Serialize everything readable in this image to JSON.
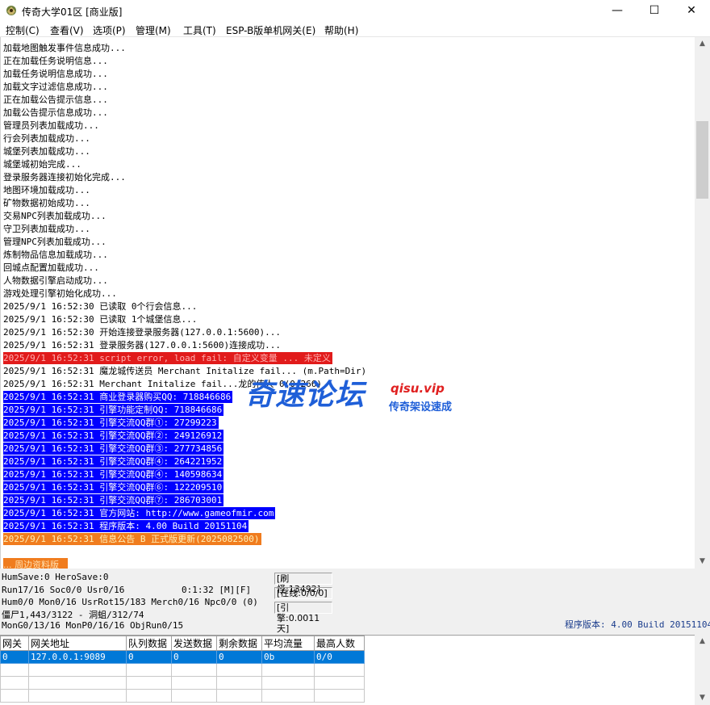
{
  "window": {
    "title": "传奇大学01区 [商业版]",
    "min_glyph": "—",
    "max_glyph": "☐",
    "close_glyph": "✕"
  },
  "menu": [
    {
      "label": "控制(C)"
    },
    {
      "label": "查看(V)"
    },
    {
      "label": "选项(P)"
    },
    {
      "label": "管理(M)"
    },
    {
      "label": "工具(T)"
    },
    {
      "label": "ESP-B版单机网关(E)"
    },
    {
      "label": "帮助(H)"
    }
  ],
  "log": {
    "lines": [
      {
        "text": "加载地图触发事件信息成功...",
        "style": ""
      },
      {
        "text": "正在加载任务说明信息...",
        "style": ""
      },
      {
        "text": "加载任务说明信息成功...",
        "style": ""
      },
      {
        "text": "加载文字过滤信息成功...",
        "style": ""
      },
      {
        "text": "正在加载公告提示信息...",
        "style": ""
      },
      {
        "text": "加载公告提示信息成功...",
        "style": ""
      },
      {
        "text": "管理员列表加载成功...",
        "style": ""
      },
      {
        "text": "行会列表加载成功...",
        "style": ""
      },
      {
        "text": "城堡列表加载成功...",
        "style": ""
      },
      {
        "text": "城堡城初始完成...",
        "style": ""
      },
      {
        "text": "登录服务器连接初始化完成...",
        "style": ""
      },
      {
        "text": "地图环境加载成功...",
        "style": ""
      },
      {
        "text": "矿物数据初始成功...",
        "style": ""
      },
      {
        "text": "交易NPC列表加载成功...",
        "style": ""
      },
      {
        "text": "守卫列表加载成功...",
        "style": ""
      },
      {
        "text": "管理NPC列表加载成功...",
        "style": ""
      },
      {
        "text": "炼制物品信息加载成功...",
        "style": ""
      },
      {
        "text": "回城点配置加载成功...",
        "style": ""
      },
      {
        "text": "人物数据引擎启动成功...",
        "style": ""
      },
      {
        "text": "游戏处理引擎初始化成功...",
        "style": ""
      },
      {
        "text": "2025/9/1 16:52:30 已读取 0个行会信息...",
        "style": ""
      },
      {
        "text": "2025/9/1 16:52:30 已读取 1个城堡信息...",
        "style": ""
      },
      {
        "text": "2025/9/1 16:52:30 开始连接登录服务器(127.0.0.1:5600)...",
        "style": ""
      },
      {
        "text": "2025/9/1 16:52:31 登录服务器(127.0.0.1:5600)连接成功...",
        "style": ""
      },
      {
        "text": "2025/9/1 16:52:31 script error, load fail: 自定义变量 ... 未定义",
        "style": "red"
      },
      {
        "text": "2025/9/1 16:52:31 魔龙城传送员 Merchant Initalize fail... (m.Path=Dir)",
        "style": ""
      },
      {
        "text": "2025/9/1 16:52:31 Merchant Initalize fail...龙的传人 0(0:266)",
        "style": ""
      },
      {
        "text": "2025/9/1 16:52:31 商业登录器购买QQ: 718846686",
        "style": "blue"
      },
      {
        "text": "2025/9/1 16:52:31 引擎功能定制QQ: 718846686",
        "style": "blue"
      },
      {
        "text": "2025/9/1 16:52:31 引擎交流QQ群①: 27299223",
        "style": "blue"
      },
      {
        "text": "2025/9/1 16:52:31 引擎交流QQ群②: 249126912",
        "style": "blue"
      },
      {
        "text": "2025/9/1 16:52:31 引擎交流QQ群③: 277734856",
        "style": "blue"
      },
      {
        "text": "2025/9/1 16:52:31 引擎交流QQ群④: 264221952",
        "style": "blue"
      },
      {
        "text": "2025/9/1 16:52:31 引擎交流QQ群④: 140598634",
        "style": "blue"
      },
      {
        "text": "2025/9/1 16:52:31 引擎交流QQ群⑥: 122209510",
        "style": "blue"
      },
      {
        "text": "2025/9/1 16:52:31 引擎交流QQ群⑦: 286703001",
        "style": "blue"
      },
      {
        "text": "2025/9/1 16:52:31 官方网站: http://www.gameofmir.com",
        "style": "blue"
      },
      {
        "text": "2025/9/1 16:52:31 程序版本: 4.00 Build 20151104",
        "style": "blue"
      },
      {
        "text": "2025/9/1 16:52:31 信息公告 B 正式版更新(2025082500)",
        "style": "orange"
      }
    ],
    "partial_line": "... 周边资料版"
  },
  "watermark": {
    "big": "奇速论坛",
    "url": "qisu.vip",
    "sub": "传奇架设速成"
  },
  "status": {
    "line1": "HumSave:0 HeroSave:0",
    "line2": "Run17/16 Soc0/0 Usr0/16",
    "time": "0:1:32 [M][F]",
    "line3": "Hum0/0 Mon0/16 UsrRot15/183 Merch0/16 Npc0/0 (0)",
    "line4": "僵尸1,443/3122 - 洞蛆/312/74",
    "line5": "MonG0/13/16 MonP0/16/16 ObjRun0/15",
    "refresh": "[刷怪:13492]",
    "online": "[在线:0/0/0]",
    "engine": "[引擎:0.0011天]",
    "version": "程序版本: 4.00 Build 20151104"
  },
  "gate_table": {
    "headers": [
      "网关",
      "网关地址",
      "队列数据",
      "发送数据",
      "剩余数据",
      "平均流量",
      "最高人数"
    ],
    "rows": [
      [
        "0",
        "127.0.0.1:9089",
        "0",
        "0",
        "0",
        "0b",
        "0/0"
      ],
      [
        "",
        "",
        "",
        "",
        "",
        "",
        ""
      ],
      [
        "",
        "",
        "",
        "",
        "",
        "",
        ""
      ],
      [
        "",
        "",
        "",
        "",
        "",
        "",
        ""
      ]
    ]
  }
}
